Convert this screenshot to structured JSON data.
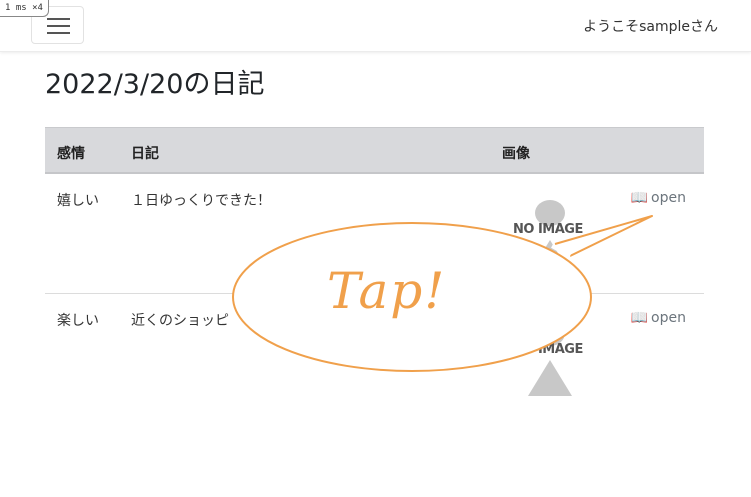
{
  "debug_badge": "1 ms ×4",
  "navbar": {
    "menu_icon": "hamburger-icon",
    "welcome_text": "ようこそsampleさん"
  },
  "page": {
    "title": "2022/3/20の日記"
  },
  "table": {
    "headers": {
      "emotion": "感情",
      "diary": "日記",
      "image": "画像"
    },
    "rows": [
      {
        "emotion": "嬉しい",
        "diary": "１日ゆっくりできた！",
        "image_label": "NO IMAGE",
        "open_label": "open",
        "open_icon": "book-icon"
      },
      {
        "emotion": "楽しい",
        "diary": "近くのショッピ",
        "image_label": "NO IMAGE",
        "open_label": "open",
        "open_icon": "book-icon"
      }
    ]
  },
  "callout": {
    "text": "Tap!",
    "color": "#f0a04b"
  }
}
